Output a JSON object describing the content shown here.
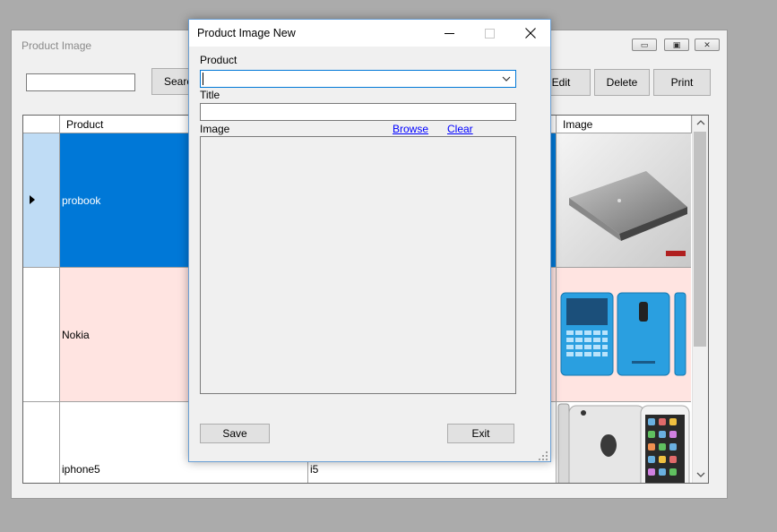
{
  "main_window": {
    "title": "Product Image",
    "toolbar": {
      "search_value": "",
      "search_label": "Search",
      "edit_label": "Edit",
      "delete_label": "Delete",
      "print_label": "Print"
    },
    "grid": {
      "columns": [
        "Product",
        "",
        "Image"
      ],
      "rows": [
        {
          "product": "probook",
          "title": "",
          "image_icon": "laptop-image",
          "selected": true
        },
        {
          "product": "Nokia",
          "title": "",
          "image_icon": "phone-image"
        },
        {
          "product": "iphone5",
          "title": "i5",
          "image_icon": "iphone-image"
        }
      ]
    }
  },
  "dialog": {
    "title": "Product Image New",
    "product_label": "Product",
    "product_value": "",
    "title_label": "Title",
    "title_value": "",
    "image_label": "Image",
    "browse_label": "Browse",
    "clear_label": "Clear",
    "save_label": "Save",
    "exit_label": "Exit"
  },
  "colors": {
    "selection_blue": "#0078d7",
    "row_pink": "#ffe4e1",
    "row_header_selected": "#bfdcf5",
    "window_bg": "#f0f0f0",
    "desktop_bg": "#ababab"
  }
}
